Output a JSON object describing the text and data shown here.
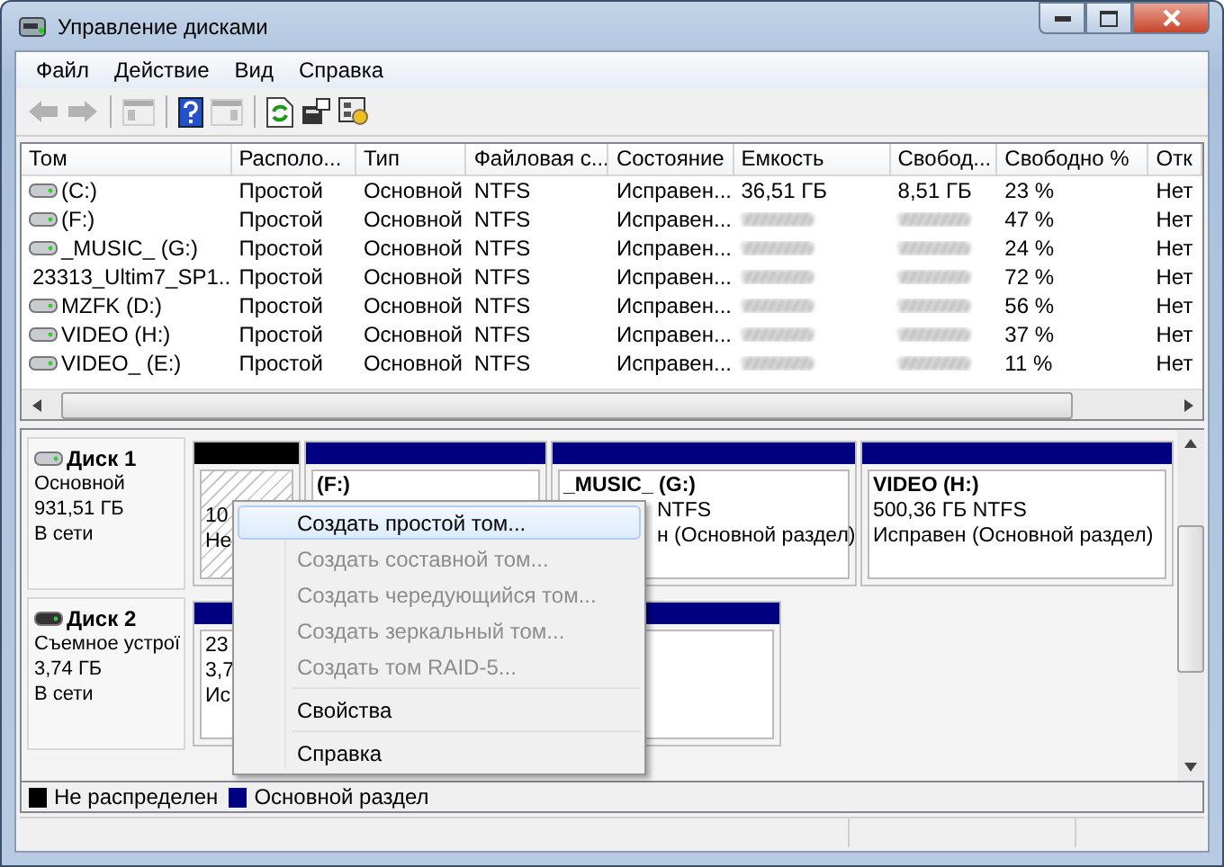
{
  "window": {
    "title": "Управление дисками"
  },
  "menu": [
    "Файл",
    "Действие",
    "Вид",
    "Справка"
  ],
  "toolbar": [
    {
      "kind": "back",
      "disabled": true
    },
    {
      "kind": "forward",
      "disabled": true
    },
    {
      "kind": "sep"
    },
    {
      "kind": "tree",
      "disabled": true
    },
    {
      "kind": "sep"
    },
    {
      "kind": "help",
      "disabled": false
    },
    {
      "kind": "pane",
      "disabled": true
    },
    {
      "kind": "sep"
    },
    {
      "kind": "refresh",
      "disabled": false
    },
    {
      "kind": "properties",
      "disabled": false
    },
    {
      "kind": "settings",
      "disabled": false
    }
  ],
  "table": {
    "columns": [
      "Том",
      "Располо...",
      "Тип",
      "Файловая с...",
      "Состояние",
      "Емкость",
      "Свобод...",
      "Свободно %",
      "Отк"
    ],
    "rows": [
      {
        "kind": "hdd",
        "volume": "(C:)",
        "layout": "Простой",
        "type": "Основной",
        "fs": "NTFS",
        "status": "Исправен...",
        "capacity": "36,51 ГБ",
        "free": "8,51 ГБ",
        "free_pct": "23 %",
        "fault": "Нет"
      },
      {
        "kind": "hdd",
        "volume": "(F:)",
        "layout": "Простой",
        "type": "Основной",
        "fs": "NTFS",
        "status": "Исправен...",
        "free_pct": "47 %",
        "fault": "Нет"
      },
      {
        "kind": "hdd",
        "volume": "_MUSIC_ (G:)",
        "layout": "Простой",
        "type": "Основной",
        "fs": "NTFS",
        "status": "Исправен...",
        "free_pct": "24 %",
        "fault": "Нет"
      },
      {
        "kind": "removable",
        "volume": "23313_Ultim7_SP1...",
        "layout": "Простой",
        "type": "Основной",
        "fs": "NTFS",
        "status": "Исправен...",
        "free_pct": "72 %",
        "fault": "Нет"
      },
      {
        "kind": "hdd",
        "volume": "MZFK (D:)",
        "layout": "Простой",
        "type": "Основной",
        "fs": "NTFS",
        "status": "Исправен...",
        "free_pct": "56 %",
        "fault": "Нет"
      },
      {
        "kind": "hdd",
        "volume": "VIDEO (H:)",
        "layout": "Простой",
        "type": "Основной",
        "fs": "NTFS",
        "status": "Исправен...",
        "free_pct": "37 %",
        "fault": "Нет"
      },
      {
        "kind": "hdd",
        "volume": "VIDEO_ (E:)",
        "layout": "Простой",
        "type": "Основной",
        "fs": "NTFS",
        "status": "Исправен...",
        "free_pct": "11 %",
        "fault": "Нет"
      }
    ]
  },
  "disks": [
    {
      "kind": "hdd",
      "name": "Диск 1",
      "lines": [
        "Основной",
        "931,51 ГБ",
        "В сети"
      ],
      "partitions": [
        {
          "kind": "unallocated",
          "lines": [
            "10",
            "Не"
          ]
        },
        {
          "kind": "primary",
          "lines": [
            "(F:)"
          ]
        },
        {
          "kind": "primary",
          "lines": [
            "_MUSIC_ (G:)",
            "NTFS",
            "н (Основной раздел)"
          ]
        },
        {
          "kind": "primary",
          "lines": [
            "VIDEO  (H:)",
            "500,36 ГБ NTFS",
            "Исправен (Основной раздел)"
          ]
        }
      ]
    },
    {
      "kind": "removable",
      "name": "Диск 2",
      "lines": [
        "Съемное устрої",
        "3,74 ГБ",
        "В сети"
      ],
      "partitions": [
        {
          "kind": "primary",
          "lines": [
            "23",
            "3,7",
            "Ис"
          ]
        }
      ]
    }
  ],
  "legend": [
    {
      "kind": "unallocated",
      "label": "Не распределен"
    },
    {
      "kind": "primary",
      "label": "Основной раздел"
    }
  ],
  "context_menu": [
    {
      "kind": "item",
      "label": "Создать простой том...",
      "disabled": false,
      "selected": true
    },
    {
      "kind": "item",
      "label": "Создать составной том...",
      "disabled": true,
      "selected": false
    },
    {
      "kind": "item",
      "label": "Создать чередующийся том...",
      "disabled": true,
      "selected": false
    },
    {
      "kind": "item",
      "label": "Создать зеркальный том...",
      "disabled": true,
      "selected": false
    },
    {
      "kind": "item",
      "label": "Создать том RAID-5...",
      "disabled": true,
      "selected": false
    },
    {
      "kind": "sep"
    },
    {
      "kind": "item",
      "label": "Свойства",
      "disabled": false,
      "selected": false
    },
    {
      "kind": "sep"
    },
    {
      "kind": "item",
      "label": "Справка",
      "disabled": false,
      "selected": false
    }
  ]
}
